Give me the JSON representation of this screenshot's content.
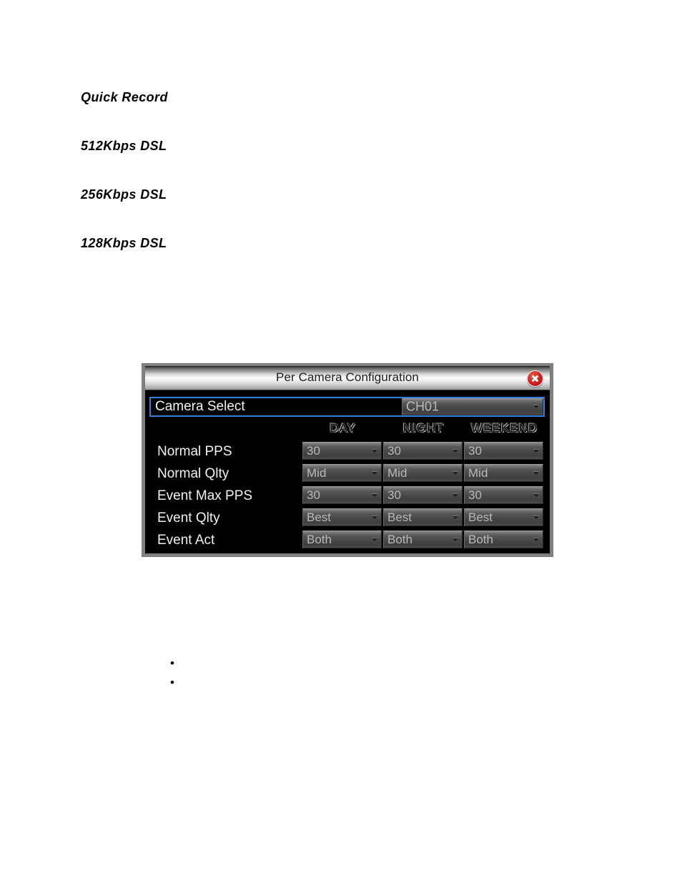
{
  "document": {
    "headings": [
      {
        "text": "Quick Record"
      },
      {
        "text": "512Kbps DSL"
      },
      {
        "text": "256Kbps DSL"
      },
      {
        "text": "128Kbps DSL"
      }
    ],
    "bullets": [
      {
        "text": ""
      },
      {
        "text": ""
      }
    ]
  },
  "dialog": {
    "title": "Per Camera Configuration",
    "close_icon": "close-icon",
    "accent_color": "#2f7fe0",
    "close_color": "#cf1f20",
    "camera_select": {
      "label": "Camera Select",
      "value": "CH01",
      "arrow_icon": "chevron-down-icon"
    },
    "columns": [
      {
        "label": "DAY"
      },
      {
        "label": "NIGHT"
      },
      {
        "label": "WEEKEND"
      }
    ],
    "rows": [
      {
        "label": "Normal PPS",
        "values": [
          {
            "value": "30",
            "arrow_icon": "chevron-down-icon"
          },
          {
            "value": "30",
            "arrow_icon": "chevron-down-icon"
          },
          {
            "value": "30",
            "arrow_icon": "chevron-down-icon"
          }
        ]
      },
      {
        "label": "Normal Qlty",
        "values": [
          {
            "value": "Mid",
            "arrow_icon": "chevron-down-icon"
          },
          {
            "value": "Mid",
            "arrow_icon": "chevron-down-icon"
          },
          {
            "value": "Mid",
            "arrow_icon": "chevron-down-icon"
          }
        ]
      },
      {
        "label": "Event Max PPS",
        "values": [
          {
            "value": "30",
            "arrow_icon": "chevron-down-icon"
          },
          {
            "value": "30",
            "arrow_icon": "chevron-down-icon"
          },
          {
            "value": "30",
            "arrow_icon": "chevron-down-icon"
          }
        ]
      },
      {
        "label": "Event Qlty",
        "values": [
          {
            "value": "Best",
            "arrow_icon": "chevron-down-icon"
          },
          {
            "value": "Best",
            "arrow_icon": "chevron-down-icon"
          },
          {
            "value": "Best",
            "arrow_icon": "chevron-down-icon"
          }
        ]
      },
      {
        "label": "Event Act",
        "values": [
          {
            "value": "Both",
            "arrow_icon": "chevron-down-icon"
          },
          {
            "value": "Both",
            "arrow_icon": "chevron-down-icon"
          },
          {
            "value": "Both",
            "arrow_icon": "chevron-down-icon"
          }
        ]
      }
    ]
  }
}
